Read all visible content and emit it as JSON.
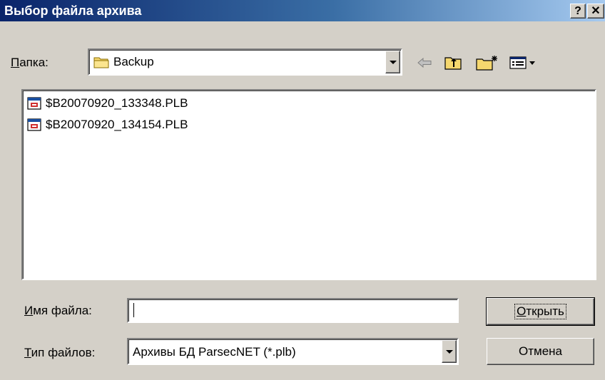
{
  "window": {
    "title": "Выбор файла архива",
    "help_label": "?",
    "close_label": "✕"
  },
  "folder": {
    "label_hotkey": "П",
    "label_rest": "апка:",
    "current": "Backup"
  },
  "toolbar": {
    "back_icon": "back-arrow-icon",
    "up_icon": "up-folder-icon",
    "new_icon": "new-folder-icon",
    "view_icon": "view-menu-icon"
  },
  "files": [
    {
      "name": "$B20070920_133348.PLB"
    },
    {
      "name": "$B20070920_134154.PLB"
    }
  ],
  "filename": {
    "label_hotkey": "И",
    "label_rest": "мя файла:",
    "value": ""
  },
  "filetype": {
    "label_hotkey": "Т",
    "label_rest": "ип файлов:",
    "selected": "Архивы БД ParsecNET (*.plb)"
  },
  "buttons": {
    "open_hotkey": "О",
    "open_rest": "ткрыть",
    "cancel": "Отмена"
  },
  "colors": {
    "titlebar_start": "#0a246a",
    "titlebar_end": "#a6caf0",
    "face": "#d4d0c8"
  }
}
